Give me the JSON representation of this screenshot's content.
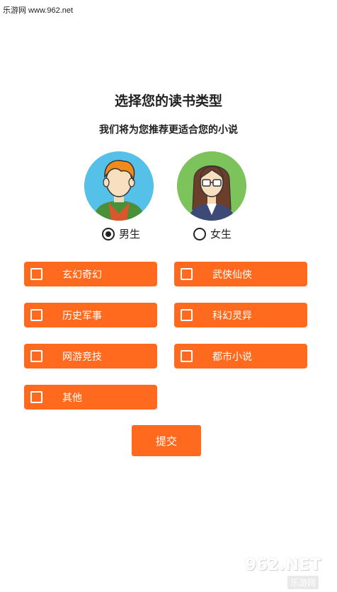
{
  "watermark": {
    "top": "乐游网 www.962.net"
  },
  "header": {
    "title": "选择您的读书类型",
    "subtitle": "我们将为您推荐更适合您的小说"
  },
  "gender": {
    "male_label": "男生",
    "female_label": "女生",
    "selected": "male"
  },
  "categories": [
    {
      "label": "玄幻奇幻",
      "checked": false
    },
    {
      "label": "武侠仙侠",
      "checked": false
    },
    {
      "label": "历史军事",
      "checked": false
    },
    {
      "label": "科幻灵异",
      "checked": false
    },
    {
      "label": "网游竞技",
      "checked": false
    },
    {
      "label": "都市小说",
      "checked": false
    },
    {
      "label": "其他",
      "checked": false
    }
  ],
  "submit_label": "提交",
  "logo": {
    "main": "962.NET",
    "sub": "乐游网"
  },
  "colors": {
    "accent": "#ff6a1f",
    "male_avatar_bg": "#56c1e8",
    "female_avatar_bg": "#7cc35b"
  }
}
